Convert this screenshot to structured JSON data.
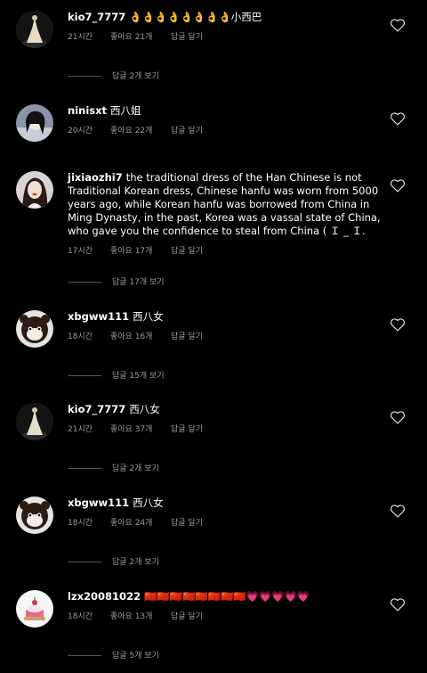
{
  "comments": [
    {
      "username": "kio7_7777",
      "text": "👌👌👌👌👌👌👌👌小西巴",
      "time": "21시간",
      "likes": "좋아요 21개",
      "reply": "답글 달기",
      "view_replies": "답글 2개 보기",
      "avatar": "dress-figure"
    },
    {
      "username": "ninisxt",
      "text": "西八姐",
      "time": "20시간",
      "likes": "좋아요 22개",
      "reply": "답글 달기",
      "view_replies": "답글 2개 보기",
      "avatar": "girl-photo"
    },
    {
      "username": "jixiaozhi7",
      "text": "the traditional dress of the Han Chinese  is not Traditional Korean dress, Chinese hanfu was worn from 5000 years ago, while Korean hanfu was borrowed from China in Ming Dynasty, in the past, Korea was a vassal state of China, who gave you the confidence to steal from China ( Ｉ _ Ｉ.",
      "time": "17시간",
      "likes": "좋아요 17개",
      "reply": "답글 달기",
      "view_replies": "답글 17개 보기",
      "avatar": "woman-portrait"
    },
    {
      "username": "xbgww111",
      "text": "西八女",
      "time": "18시간",
      "likes": "좋아요 16개",
      "reply": "답글 달기",
      "view_replies": "답글 15개 보기",
      "avatar": "bear-doll"
    },
    {
      "username": "kio7_7777",
      "text": "西八女",
      "time": "21시간",
      "likes": "좋아요 37개",
      "reply": "답글 달기",
      "view_replies": "답글 2개 보기",
      "avatar": "dress-figure"
    },
    {
      "username": "xbgww111",
      "text": "西八女",
      "time": "18시간",
      "likes": "좋아요 24개",
      "reply": "답글 달기",
      "view_replies": "답글 2개 보기",
      "avatar": "bear-doll"
    },
    {
      "username": "lzx20081022",
      "text": "🇨🇳🇨🇳🇨🇳🇨🇳🇨🇳🇨🇳🇨🇳🇨🇳💗💗💗💗💗",
      "time": "18시간",
      "likes": "좋아요 13개",
      "reply": "답글 달기",
      "view_replies": "답글 5개 보기",
      "avatar": "cake-cartoon"
    }
  ],
  "icons": {
    "like": "heart-outline-icon"
  },
  "colors": {
    "background": "#000000",
    "text": "#ffffff",
    "meta": "#9a9a9a"
  }
}
